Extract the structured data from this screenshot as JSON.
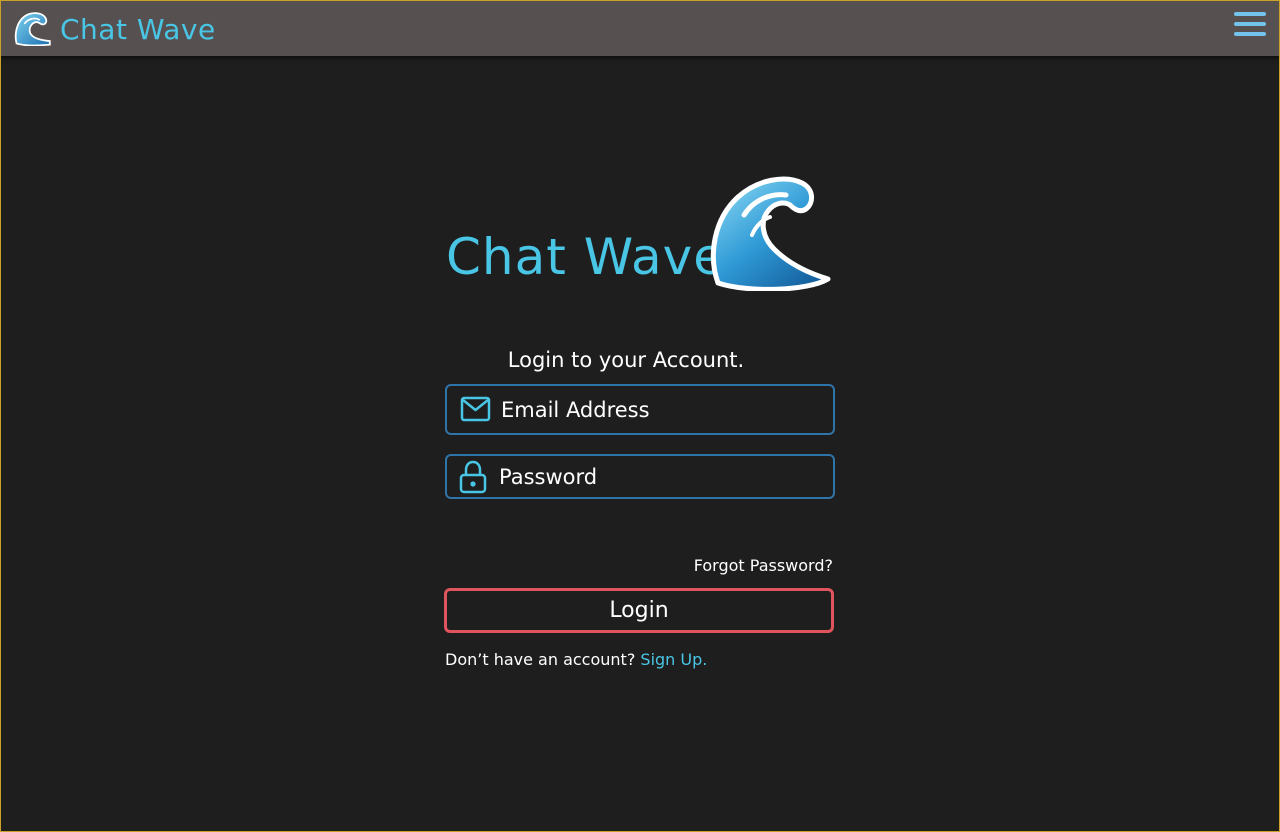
{
  "app": {
    "title": "Chat Wave",
    "brand_color": "#49c6e5"
  },
  "navbar": {
    "title": "Chat Wave",
    "logo_icon": "wave-icon",
    "menu_icon": "hamburger-menu-icon",
    "background": "#565050"
  },
  "hero": {
    "title": "Chat Wave",
    "logo_icon": "wave-icon"
  },
  "form": {
    "subtitle": "Login to your Account.",
    "email": {
      "placeholder": "Email Address",
      "value": "",
      "icon": "envelope-icon"
    },
    "password": {
      "placeholder": "Password",
      "value": "",
      "icon": "lock-icon"
    },
    "forgot_label": "Forgot Password?",
    "login_label": "Login",
    "login_border_color": "#e0545e",
    "field_border_color": "#2f74a8",
    "signup_prompt": "Don’t have an account?",
    "signup_link": "Sign Up."
  }
}
